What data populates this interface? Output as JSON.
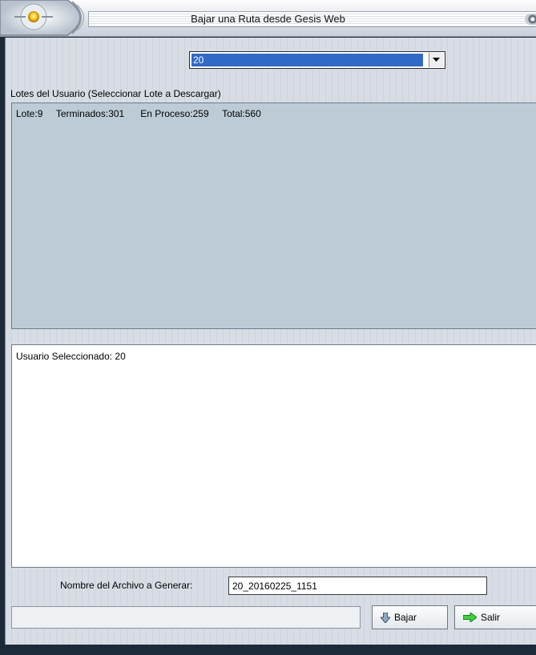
{
  "window": {
    "title": "Bajar una Ruta desde Gesis Web"
  },
  "user_combo": {
    "selected": "20"
  },
  "lotes": {
    "label": "Lotes del Usuario (Seleccionar Lote a Descargar)",
    "rows": [
      {
        "lote": "Lote:9",
        "terminados": "Terminados:301",
        "en_proceso": "En Proceso:259",
        "total": "Total:560"
      }
    ]
  },
  "memo": {
    "text": "Usuario Seleccionado: 20"
  },
  "archivo": {
    "label": "Nombre del Archivo a Generar:",
    "value": "20_20160225_1151"
  },
  "status": {
    "text": ""
  },
  "buttons": {
    "bajar": "Bajar",
    "salir": "Salir"
  },
  "icons": {
    "bajar": "arrow-down-icon",
    "salir": "arrow-right-icon"
  },
  "colors": {
    "selection": "#3169c6",
    "list_background": "#bccbd6",
    "frame": "#1c2a3a"
  }
}
